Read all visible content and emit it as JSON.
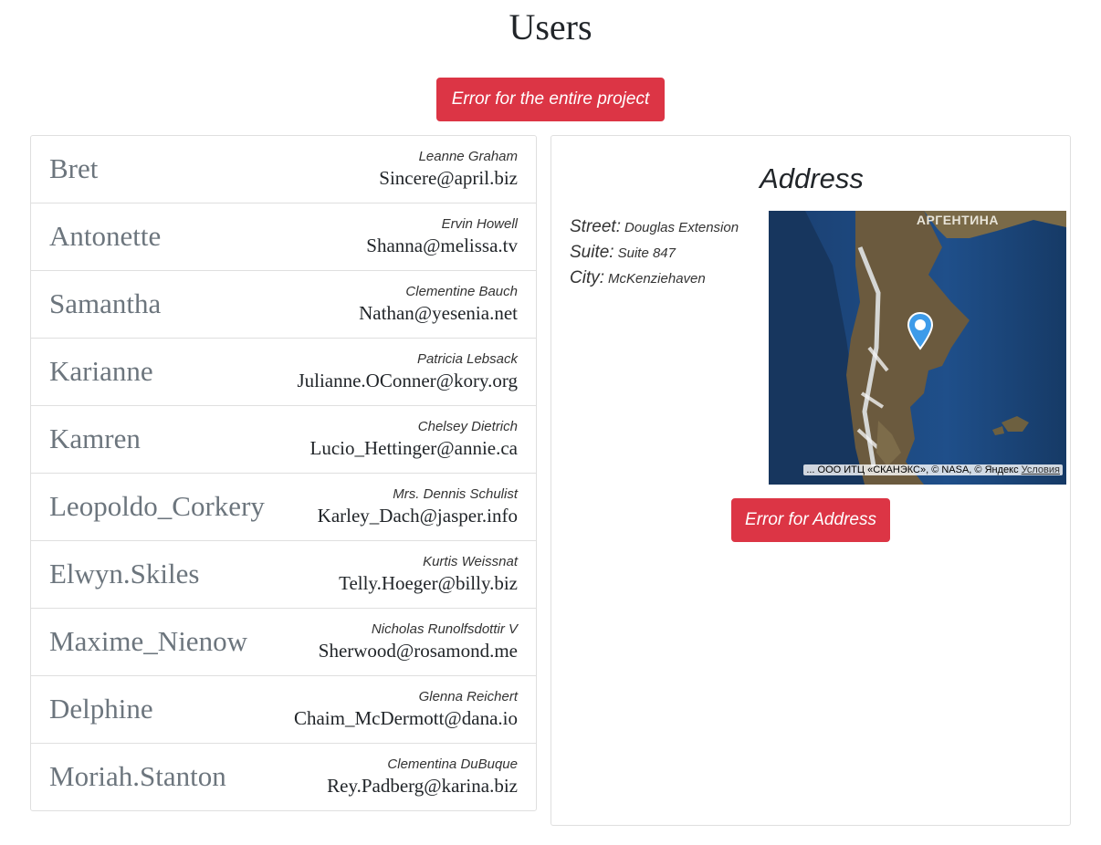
{
  "page": {
    "title": "Users"
  },
  "buttons": {
    "project_error": "Error for the entire project",
    "address_error": "Error for Address"
  },
  "users": [
    {
      "username": "Bret",
      "name": "Leanne Graham",
      "email": "Sincere@april.biz"
    },
    {
      "username": "Antonette",
      "name": "Ervin Howell",
      "email": "Shanna@melissa.tv"
    },
    {
      "username": "Samantha",
      "name": "Clementine Bauch",
      "email": "Nathan@yesenia.net"
    },
    {
      "username": "Karianne",
      "name": "Patricia Lebsack",
      "email": "Julianne.OConner@kory.org"
    },
    {
      "username": "Kamren",
      "name": "Chelsey Dietrich",
      "email": "Lucio_Hettinger@annie.ca"
    },
    {
      "username": "Leopoldo_Corkery",
      "name": "Mrs. Dennis Schulist",
      "email": "Karley_Dach@jasper.info"
    },
    {
      "username": "Elwyn.Skiles",
      "name": "Kurtis Weissnat",
      "email": "Telly.Hoeger@billy.biz"
    },
    {
      "username": "Maxime_Nienow",
      "name": "Nicholas Runolfsdottir V",
      "email": "Sherwood@rosamond.me"
    },
    {
      "username": "Delphine",
      "name": "Glenna Reichert",
      "email": "Chaim_McDermott@dana.io"
    },
    {
      "username": "Moriah.Stanton",
      "name": "Clementina DuBuque",
      "email": "Rey.Padberg@karina.biz"
    }
  ],
  "address": {
    "title": "Address",
    "street_label": "Street:",
    "street": "Douglas Extension",
    "suite_label": "Suite:",
    "suite": "Suite 847",
    "city_label": "City:",
    "city": "McKenziehaven"
  },
  "map": {
    "country_label": "АРГЕНТИНА",
    "attribution": "... ООО ИТЦ «СКАНЭКС», © NASA, © Яндекс",
    "terms_link": "Условия",
    "pin_color": "#3d9be9",
    "ocean_color": "#1f4f8a",
    "land_color": "#6b5a3e"
  },
  "colors": {
    "danger": "#dc3545"
  }
}
